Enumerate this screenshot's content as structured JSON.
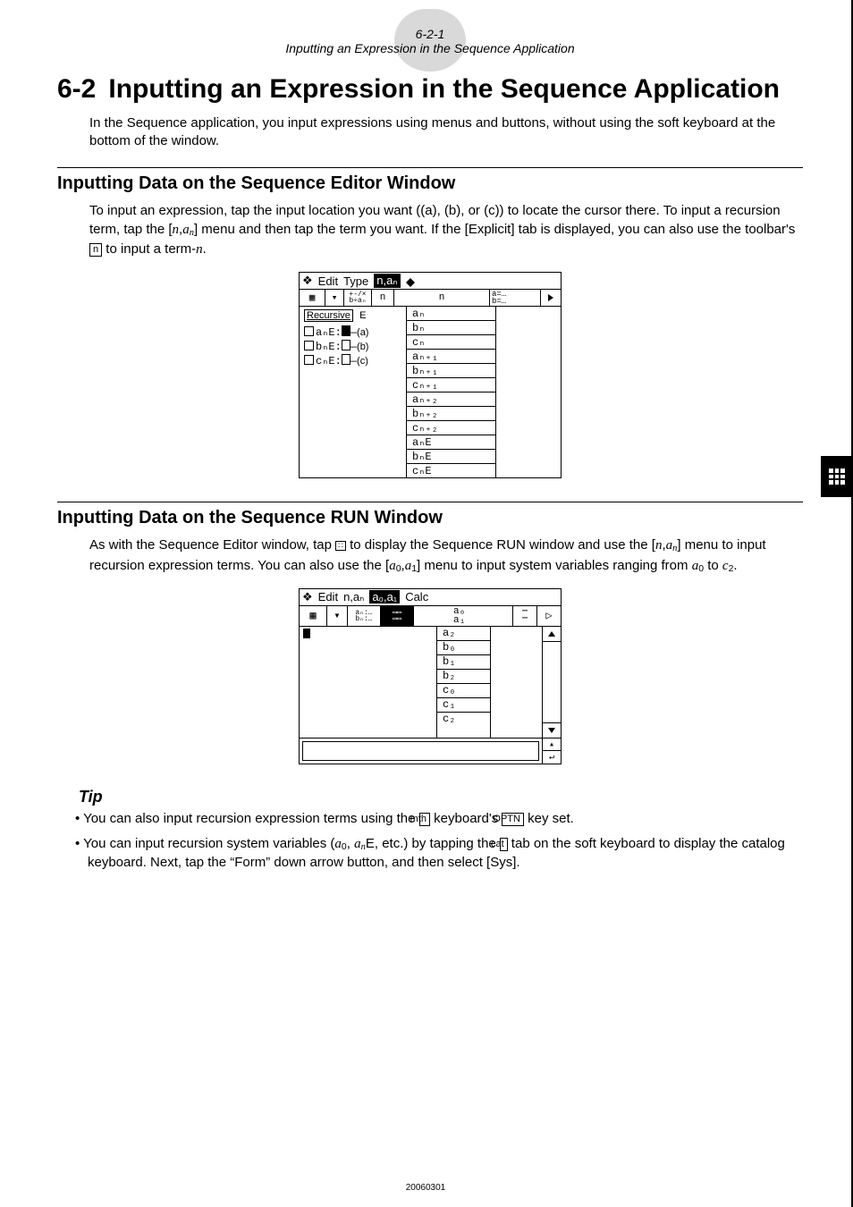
{
  "header": {
    "num": "6-2-1",
    "name": "Inputting an Expression in the Sequence Application"
  },
  "chapter": {
    "num": "6-2",
    "title": "Inputting an Expression in the Sequence Application"
  },
  "intro": "In the Sequence application, you input expressions using menus and buttons, without using the soft keyboard at the bottom of the window.",
  "sec1": {
    "title": "Inputting Data on the Sequence Editor Window",
    "body_pre": "To input an expression, tap the input location you want ((a), (b), or (c)) to locate the cursor there. To input a recursion term, tap the [",
    "var1": "n",
    "var1b": ",",
    "var2": "a",
    "var2sub": "n",
    "body_mid": "] menu and then tap the term you want. If the [Explicit] tab is displayed, you can also use the toolbar's ",
    "btn": "n",
    "body_post_a": " to input a term-",
    "term_n": "n",
    "body_post_b": "."
  },
  "fig1": {
    "menu_edit": "Edit",
    "menu_type": "Type",
    "menu_nan_inv": "n,aₙ",
    "tool_n": "n",
    "tab_recursive": "Recursive",
    "tab_e": "E",
    "row_a": "aₙE:",
    "row_b": "bₙE:",
    "row_c": "cₙE:",
    "tag_a": "(a)",
    "tag_b": "(b)",
    "tag_c": "(c)",
    "dd_top": "n",
    "dd": [
      "aₙ",
      "bₙ",
      "cₙ",
      "aₙ₊₁",
      "bₙ₊₁",
      "cₙ₊₁",
      "aₙ₊₂",
      "bₙ₊₂",
      "cₙ₊₂",
      "aₙE",
      "bₙE",
      "cₙE"
    ],
    "right_top": [
      "a=…",
      "b=…"
    ]
  },
  "sec2": {
    "title": "Inputting Data on the Sequence RUN Window",
    "body_pre": "As with the Sequence Editor window, tap ",
    "btn": "∷",
    "body_mid_a": " to display the Sequence RUN window and use the [",
    "v1": "n",
    "v1c": ",",
    "v2": "a",
    "v2s": "n",
    "body_mid_b": "] menu to input recursion expression terms. You can also use the [",
    "v3": "a",
    "v3s": "0",
    "v3c": ",",
    "v4": "a",
    "v4s": "1",
    "body_mid_c": "] menu to input system variables ranging from ",
    "rng_a": "a",
    "rng_as": "0",
    "rng_to": " to ",
    "rng_c": "c",
    "rng_cs": "2",
    "body_end": "."
  },
  "fig2": {
    "menu_edit": "Edit",
    "menu_nan": "n,aₙ",
    "menu_a0a1_inv": "a₀,a₁",
    "menu_calc": "Calc",
    "dd_top": [
      "a₀",
      "a₁"
    ],
    "dd": [
      "a₂",
      "b₀",
      "b₁",
      "b₂",
      "c₀",
      "c₁",
      "c₂"
    ]
  },
  "tipHeading": "Tip",
  "tips": {
    "t1_a": "You can also input recursion expression terms using the ",
    "t1_key1": "mth",
    "t1_b": " keyboard's ",
    "t1_key2": "OPTN",
    "t1_c": " key set.",
    "t2_a": "You can input recursion system variables (",
    "t2_v1": "a",
    "t2_v1s": "0",
    "t2_comma": ", ",
    "t2_v2": "a",
    "t2_v2s": "n",
    "t2_v2E": "E",
    "t2_b": ", etc.) by tapping the ",
    "t2_key": "cat",
    "t2_c": " tab on the soft keyboard to display the catalog keyboard. Next, tap the “Form” down arrow button, and then select [Sys]."
  },
  "footer": "20060301"
}
